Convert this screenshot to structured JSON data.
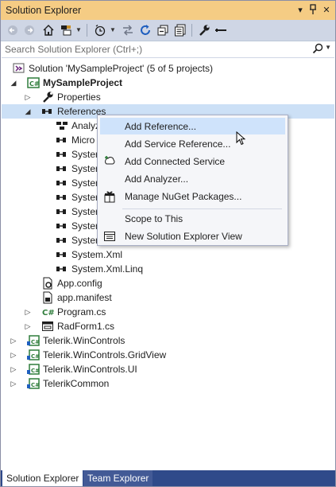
{
  "window": {
    "title": "Solution Explorer",
    "pin_glyph": "▾",
    "pin2_glyph": "⊓",
    "close_glyph": "✕"
  },
  "search": {
    "placeholder": "Search Solution Explorer (Ctrl+;)",
    "value": ""
  },
  "tree": {
    "solution": "Solution 'MySampleProject' (5 of 5 projects)",
    "project": "MySampleProject",
    "properties": "Properties",
    "references": "References",
    "ref_items": [
      "Analyz",
      "Micro",
      "Syster",
      "Syster",
      "Syster",
      "Syster",
      "Syster",
      "Syster",
      "Syster",
      "System.Xml",
      "System.Xml.Linq"
    ],
    "app_config": "App.config",
    "app_manifest": "app.manifest",
    "program_cs": "Program.cs",
    "radform": "RadForm1.cs",
    "projects": [
      "Telerik.WinControls",
      "Telerik.WinControls.GridView",
      "Telerik.WinControls.UI",
      "TelerikCommon"
    ]
  },
  "context_menu": {
    "add_reference": "Add Reference...",
    "add_service_reference": "Add Service Reference...",
    "add_connected_service": "Add Connected Service",
    "add_analyzer": "Add Analyzer...",
    "manage_nuget": "Manage NuGet Packages...",
    "scope_to_this": "Scope to This",
    "new_view": "New Solution Explorer View"
  },
  "tabs": {
    "solution_explorer": "Solution Explorer",
    "team_explorer": "Team Explorer"
  },
  "colors": {
    "title_bar": "#f5cc84",
    "toolbar": "#cfd6e5",
    "selection": "#cce0f6",
    "menu_highlight": "#cfe3fb",
    "tab_bar": "#2f4a8a",
    "csharp_green": "#2f7d3b"
  }
}
